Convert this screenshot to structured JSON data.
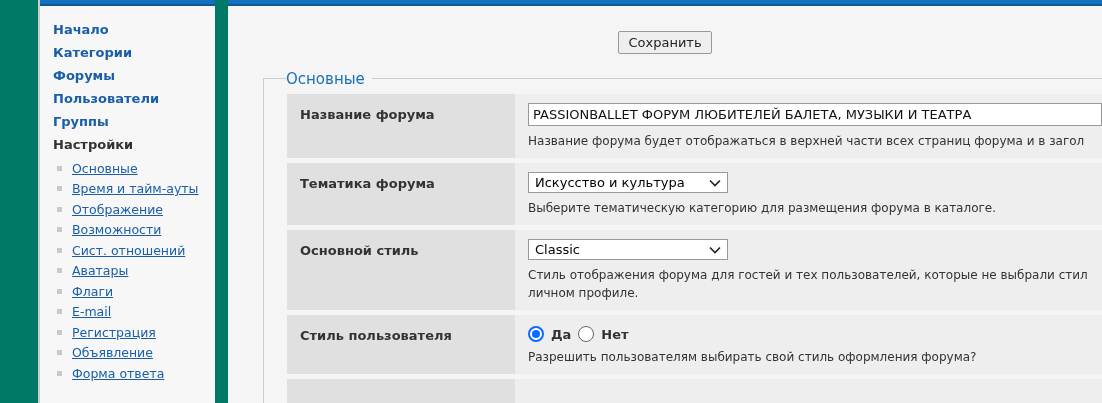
{
  "sidebar": {
    "items": [
      {
        "label": "Начало",
        "selected": false
      },
      {
        "label": "Категории",
        "selected": false
      },
      {
        "label": "Форумы",
        "selected": false
      },
      {
        "label": "Пользователи",
        "selected": false
      },
      {
        "label": "Группы",
        "selected": false
      },
      {
        "label": "Настройки",
        "selected": true,
        "children": [
          {
            "label": "Основные",
            "selected": false
          },
          {
            "label": "Время и тайм-ауты",
            "selected": false
          },
          {
            "label": "Отображение",
            "selected": false
          },
          {
            "label": "Возможности",
            "selected": false
          },
          {
            "label": "Сист. отношений",
            "selected": false
          },
          {
            "label": "Аватары",
            "selected": false
          },
          {
            "label": "Флаги",
            "selected": false
          },
          {
            "label": "E-mail",
            "selected": false
          },
          {
            "label": "Регистрация",
            "selected": false
          },
          {
            "label": "Объявление",
            "selected": false
          },
          {
            "label": "Форма ответа",
            "selected": false
          }
        ]
      }
    ]
  },
  "save_button": "Сохранить",
  "section": {
    "legend": "Основные",
    "settings": [
      {
        "kind": "text",
        "label": "Название форума",
        "value": "PASSIONBALLET ФОРУМ ЛЮБИТЕЛЕЙ БАЛЕТА, МУЗЫКИ И ТЕАТРА",
        "description": [
          "Название форума будет отображаться в верхней части всех страниц форума и в загол"
        ]
      },
      {
        "kind": "select",
        "label": "Тематика форума",
        "value": "Искусство и культура",
        "description": [
          "Выберите тематическую категорию для размещения форума в каталоге."
        ]
      },
      {
        "kind": "select",
        "label": "Основной стиль",
        "value": "Classic",
        "description": [
          "Стиль отображения форума для гостей и тех пользователей, которые не выбрали стил",
          "личном профиле."
        ]
      },
      {
        "kind": "radio",
        "label": "Стиль пользователя",
        "options": [
          {
            "label": "Да",
            "selected": true
          },
          {
            "label": "Нет",
            "selected": false
          }
        ],
        "description": [
          "Разрешить пользователям выбирать свой стиль оформления форума?"
        ]
      }
    ]
  }
}
